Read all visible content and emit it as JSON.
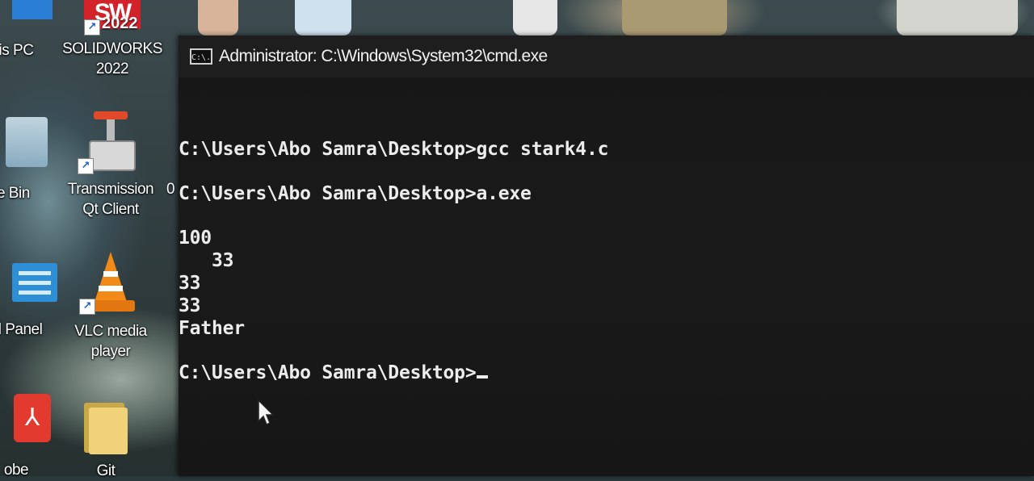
{
  "desktop": {
    "icons": [
      {
        "label": "is PC",
        "name": "this-pc"
      },
      {
        "label": "SOLIDWORKS 2022",
        "badge": "SW",
        "year": "2022",
        "name": "solidworks"
      },
      {
        "label": "cle Bin",
        "name": "recycle-bin"
      },
      {
        "label": "Transmission Qt Client",
        "name": "transmission"
      },
      {
        "label": "ol Panel",
        "name": "control-panel"
      },
      {
        "label": "VLC media player",
        "name": "vlc"
      },
      {
        "label": "obe",
        "name": "adobe"
      },
      {
        "label": "Git",
        "name": "git-folder"
      }
    ],
    "stray_label": "0"
  },
  "window": {
    "title": "Administrator: C:\\Windows\\System32\\cmd.exe",
    "icon": "C:\\."
  },
  "console": {
    "lines": [
      "C:\\Users\\Abo Samra\\Desktop>gcc stark4.c",
      "C:\\Users\\Abo Samra\\Desktop>a.exe",
      "100",
      "   33",
      "33",
      "33",
      "Father",
      "C:\\Users\\Abo Samra\\Desktop>"
    ]
  },
  "colors": {
    "console_bg": "#141414",
    "console_text": "#ececec",
    "titlebar_bg": "#1e1e1e"
  }
}
